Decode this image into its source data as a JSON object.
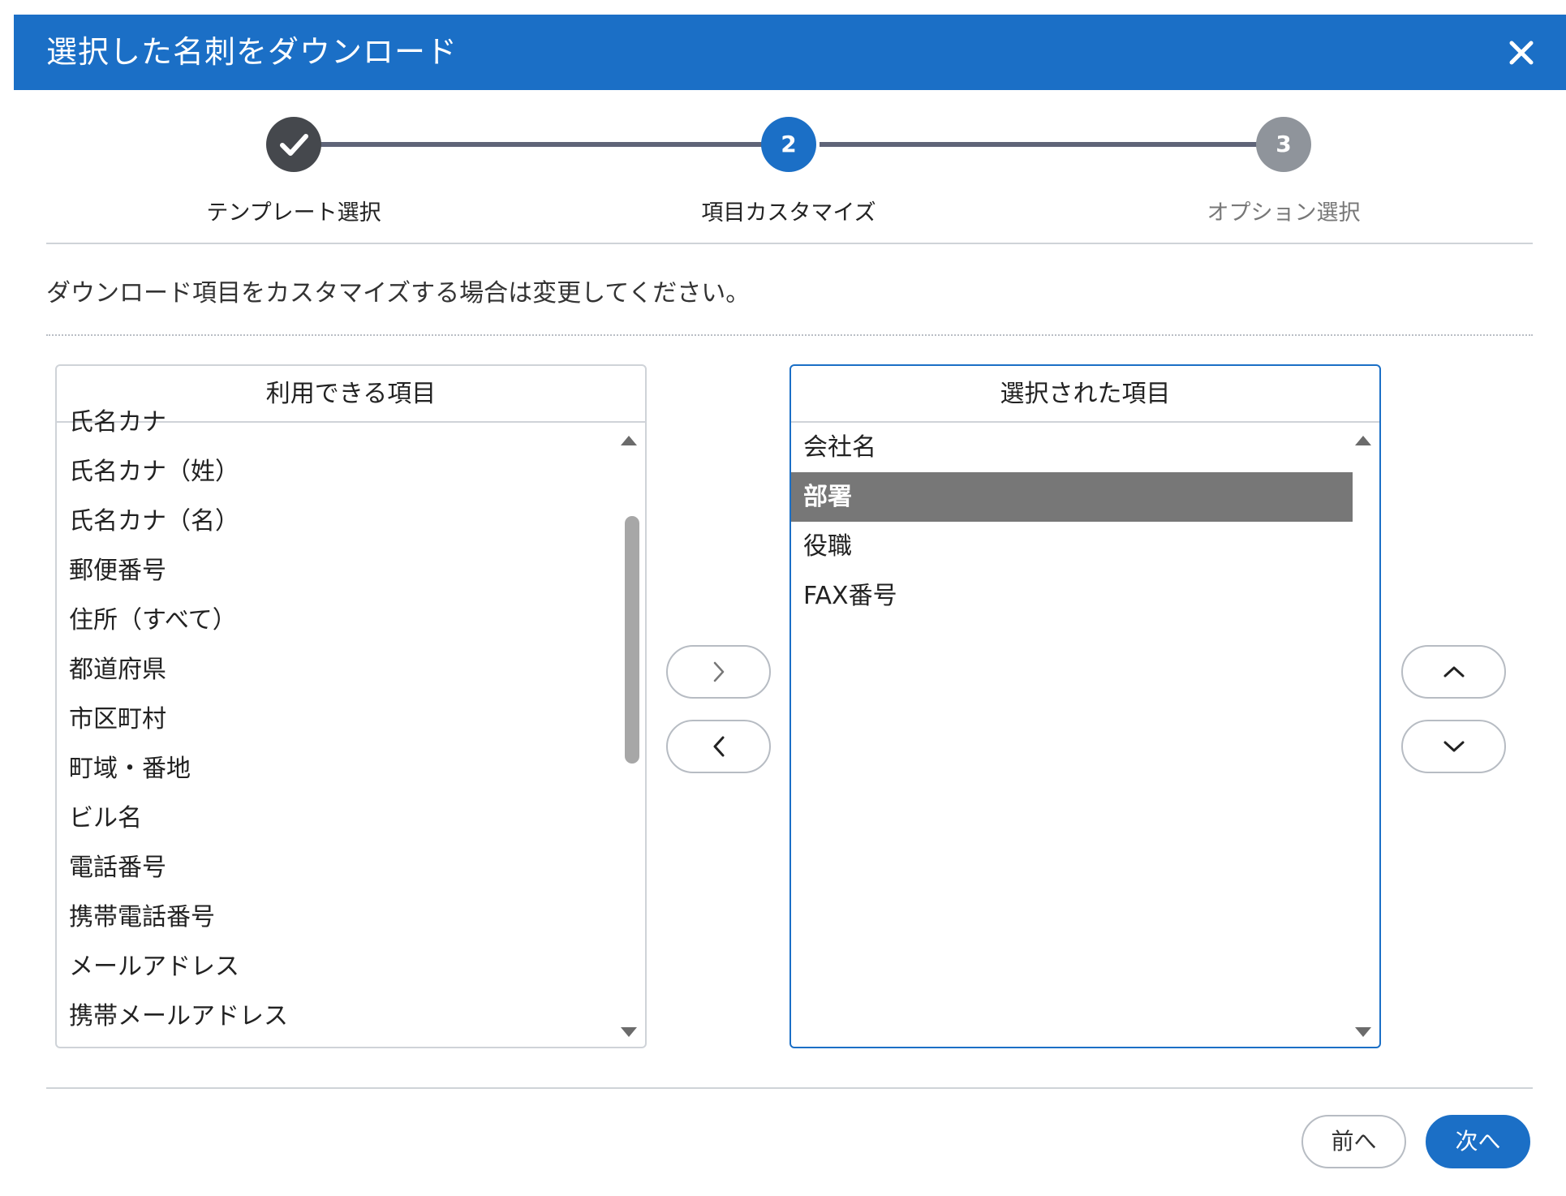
{
  "dialog": {
    "title": "選択した名刺をダウンロード",
    "close_icon": "close-icon"
  },
  "stepper": {
    "steps": [
      {
        "label": "テンプレート選択",
        "marker": "✓",
        "state": "completed"
      },
      {
        "label": "項目カスタマイズ",
        "marker": "2",
        "state": "current"
      },
      {
        "label": "オプション選択",
        "marker": "3",
        "state": "upcoming"
      }
    ]
  },
  "instruction": "ダウンロード項目をカスタマイズする場合は変更してください。",
  "available": {
    "title": "利用できる項目",
    "items": [
      "氏名カナ",
      "氏名カナ（姓）",
      "氏名カナ（名）",
      "郵便番号",
      "住所（すべて）",
      "都道府県",
      "市区町村",
      "町域・番地",
      "ビル名",
      "電話番号",
      "携帯電話番号",
      "メールアドレス",
      "携帯メールアドレス"
    ]
  },
  "selected": {
    "title": "選択された項目",
    "items": [
      "会社名",
      "部署",
      "役職",
      "FAX番号"
    ],
    "selected_index": 1
  },
  "buttons": {
    "move_right_icon": "chevron-right-icon",
    "move_left_icon": "chevron-left-icon",
    "move_up_icon": "chevron-up-icon",
    "move_down_icon": "chevron-down-icon",
    "prev": "前へ",
    "next": "次へ"
  },
  "colors": {
    "primary": "#1b6fc6",
    "completed_step": "#45484d",
    "upcoming_step": "#8f949b",
    "selected_row": "#777777"
  }
}
